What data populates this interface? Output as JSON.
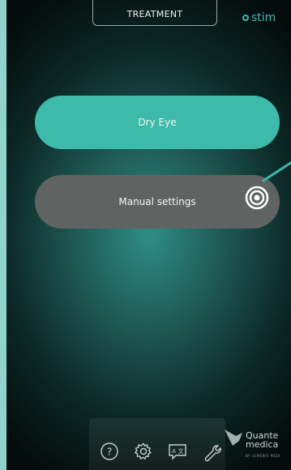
{
  "header": {
    "tab_label": "TREATMENT",
    "brand": "stim"
  },
  "main": {
    "dry_eye_label": "Dry Eye",
    "manual_settings_label": "Manual settings"
  },
  "toolbar": {
    "icons": [
      "help-icon",
      "settings-gear-icon",
      "language-icon",
      "wrench-icon"
    ]
  },
  "logo": {
    "line1": "Quante",
    "line2": "medica",
    "line3": "BY LUMENIS MEDI"
  },
  "colors": {
    "accent": "#3dbaa9",
    "manual": "#5f6463",
    "frame": "#8fd3cc"
  }
}
